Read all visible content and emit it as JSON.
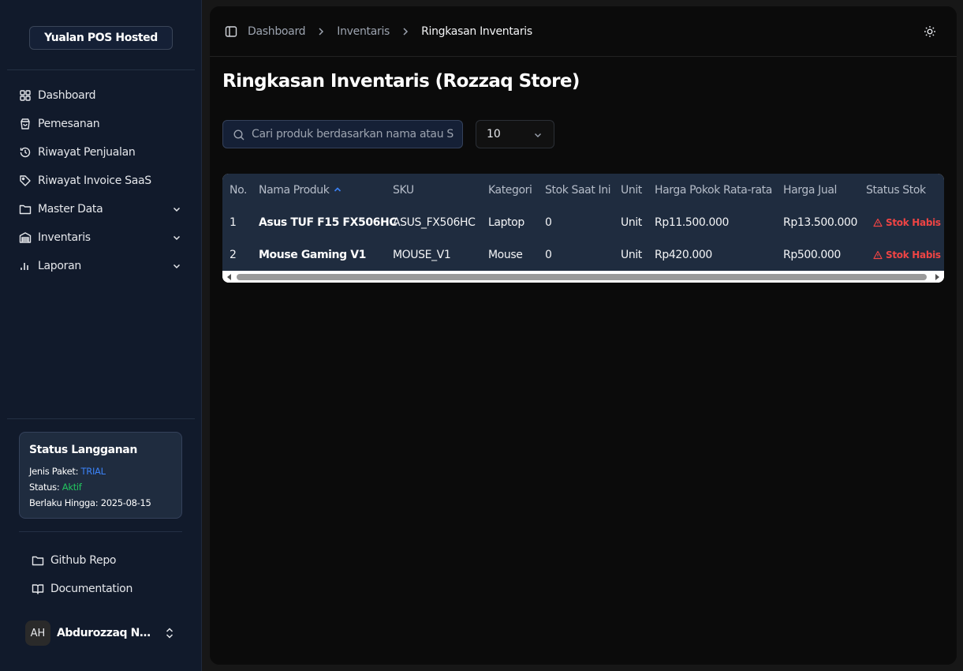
{
  "app": {
    "brand": "Yualan POS Hosted"
  },
  "sidebar": {
    "items": [
      {
        "label": "Dashboard",
        "icon": "grid-icon"
      },
      {
        "label": "Pemesanan",
        "icon": "shopping-bag-icon"
      },
      {
        "label": "Riwayat Penjualan",
        "icon": "history-icon"
      },
      {
        "label": "Riwayat Invoice SaaS",
        "icon": "tag-icon"
      },
      {
        "label": "Master Data",
        "icon": "folder-icon",
        "expandable": true
      },
      {
        "label": "Inventaris",
        "icon": "warehouse-icon",
        "expandable": true
      },
      {
        "label": "Laporan",
        "icon": "bar-chart-icon",
        "expandable": true
      }
    ],
    "subscription": {
      "title": "Status Langganan",
      "plan_label": "Jenis Paket:",
      "plan_value": "TRIAL",
      "status_label": "Status:",
      "status_value": "Aktif",
      "valid_label": "Berlaku Hingga:",
      "valid_value": "2025-08-15"
    },
    "links": [
      {
        "label": "Github Repo",
        "icon": "folder-icon"
      },
      {
        "label": "Documentation",
        "icon": "book-icon"
      }
    ],
    "user": {
      "initials": "AH",
      "name": "Abdurozzaq Nurul Hadi"
    }
  },
  "header": {
    "breadcrumbs": [
      "Dashboard",
      "Inventaris",
      "Ringkasan Inventaris"
    ]
  },
  "page": {
    "title": "Ringkasan Inventaris (Rozzaq Store)",
    "search_placeholder": "Cari produk berdasarkan nama atau SKU...",
    "page_size": "10"
  },
  "table": {
    "columns": [
      "No.",
      "Nama Produk",
      "SKU",
      "Kategori",
      "Stok Saat Ini",
      "Unit",
      "Harga Pokok Rata-rata",
      "Harga Jual",
      "Status Stok"
    ],
    "sorted_column": "Nama Produk",
    "sort_direction": "asc",
    "rows": [
      {
        "no": "1",
        "name": "Asus TUF F15 FX506HC",
        "sku": "ASUS_FX506HC",
        "category": "Laptop",
        "stock": "0",
        "unit": "Unit",
        "cost": "Rp11.500.000",
        "price": "Rp13.500.000",
        "status": "Stok Habis"
      },
      {
        "no": "2",
        "name": "Mouse Gaming V1",
        "sku": "MOUSE_V1",
        "category": "Mouse",
        "stock": "0",
        "unit": "Unit",
        "cost": "Rp420.000",
        "price": "Rp500.000",
        "status": "Stok Habis"
      }
    ]
  },
  "colors": {
    "accent": "#3b82f6",
    "success": "#22c55e",
    "danger": "#ef4444",
    "sidebar_bg": "#111a2b",
    "table_bg": "#1f2c3f"
  }
}
